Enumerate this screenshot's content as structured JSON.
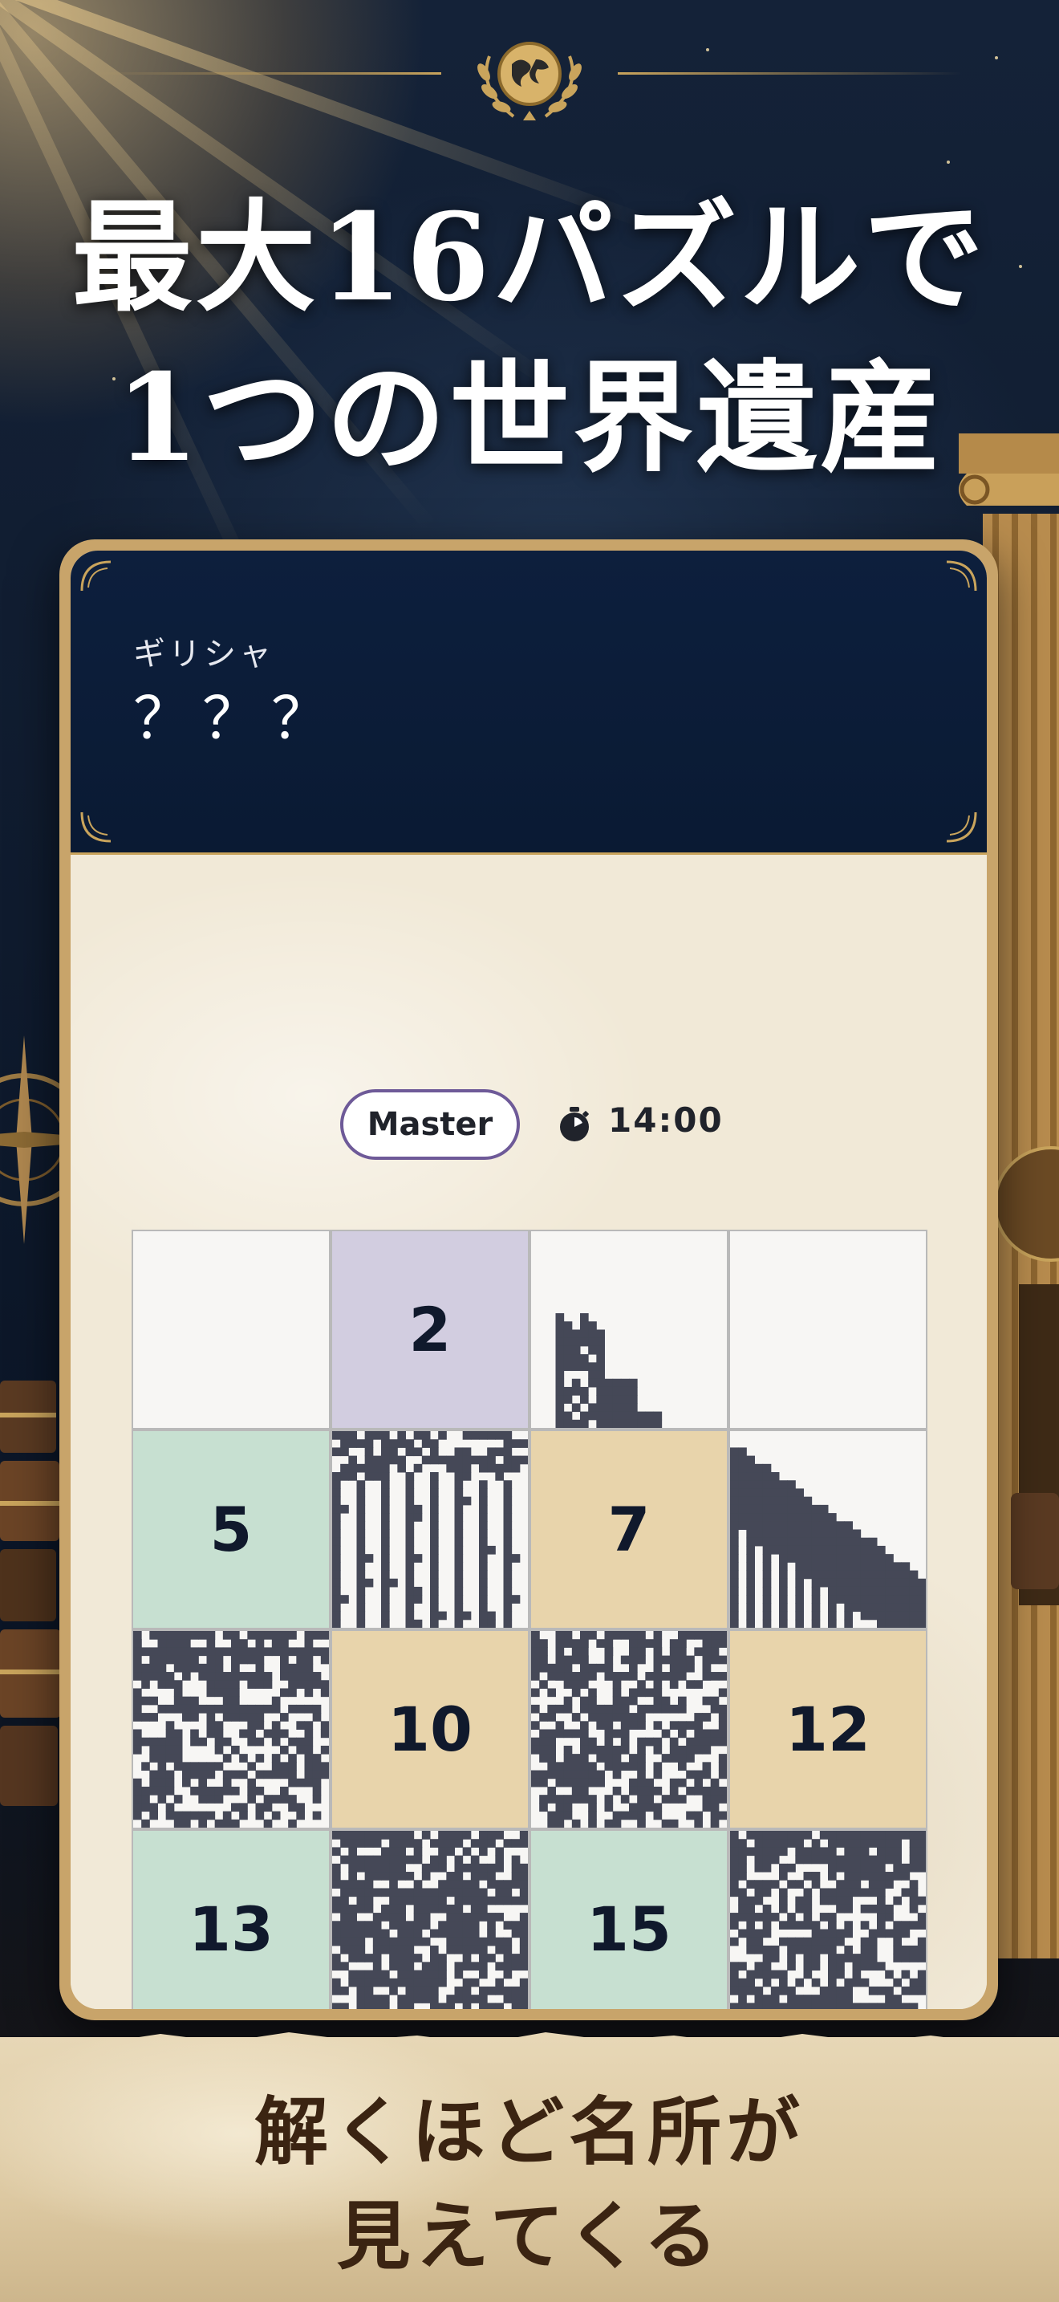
{
  "headline": {
    "line1": "最大16パズルで",
    "line2": "1つの世界遺産"
  },
  "card": {
    "region": "ギリシャ",
    "site_name": "？？？",
    "difficulty": "Master",
    "timer": "14:00",
    "timer_icon": "stopwatch-icon"
  },
  "puzzle": {
    "tiles": [
      {
        "index": 1,
        "state": "hidden",
        "label": "",
        "color": "#f7f6f4"
      },
      {
        "index": 2,
        "state": "hidden",
        "label": "2",
        "color": "#d2cde0"
      },
      {
        "index": 3,
        "state": "revealed",
        "label": "",
        "color": "#f7f6f4"
      },
      {
        "index": 4,
        "state": "hidden",
        "label": "",
        "color": "#f7f6f4"
      },
      {
        "index": 5,
        "state": "hidden",
        "label": "5",
        "color": "#c7e0d1"
      },
      {
        "index": 6,
        "state": "revealed",
        "label": "",
        "color": "#f7f6f4"
      },
      {
        "index": 7,
        "state": "hidden",
        "label": "7",
        "color": "#e8d4ab"
      },
      {
        "index": 8,
        "state": "revealed",
        "label": "",
        "color": "#f7f6f4"
      },
      {
        "index": 9,
        "state": "revealed",
        "label": "",
        "color": "#f7f6f4"
      },
      {
        "index": 10,
        "state": "hidden",
        "label": "10",
        "color": "#e8d4ab"
      },
      {
        "index": 11,
        "state": "revealed",
        "label": "",
        "color": "#f7f6f4"
      },
      {
        "index": 12,
        "state": "hidden",
        "label": "12",
        "color": "#e8d4ab"
      },
      {
        "index": 13,
        "state": "hidden",
        "label": "13",
        "color": "#c7e0d1"
      },
      {
        "index": 14,
        "state": "revealed",
        "label": "",
        "color": "#f7f6f4"
      },
      {
        "index": 15,
        "state": "hidden",
        "label": "15",
        "color": "#c7e0d1"
      },
      {
        "index": 16,
        "state": "revealed",
        "label": "",
        "color": "#f7f6f4"
      }
    ],
    "pixel_color": "#454857"
  },
  "banner": {
    "line1": "解くほど名所が",
    "line2": "見えてくる"
  },
  "colors": {
    "card_header": "#0d1f3d",
    "gold": "#c9a45c",
    "pill_border": "#6e5a98"
  },
  "icons": {
    "emblem": "globe-laurel-icon",
    "compass": "compass-icon",
    "column": "greek-column-icon"
  }
}
